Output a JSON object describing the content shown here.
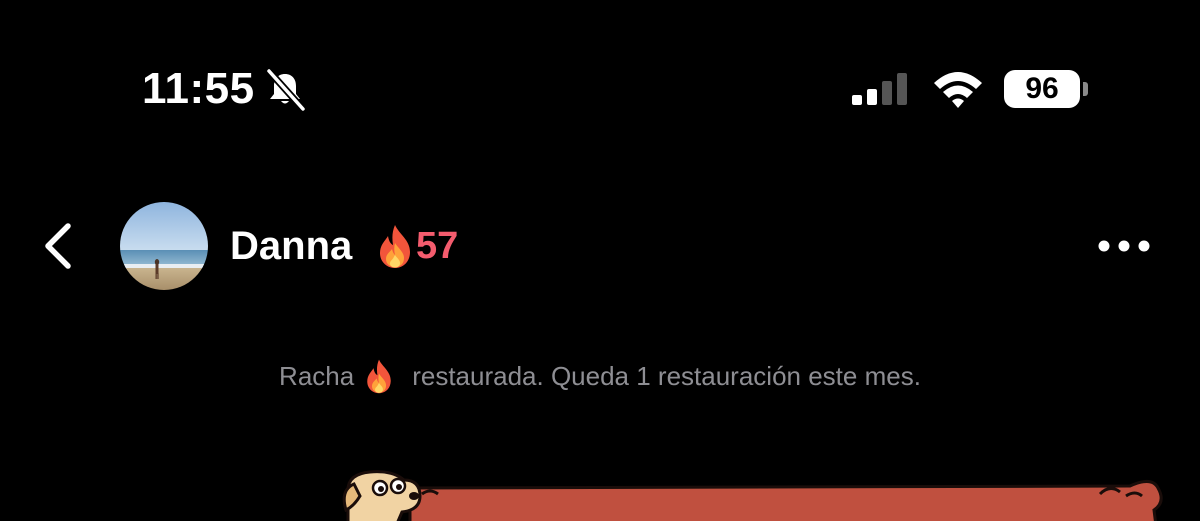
{
  "status_bar": {
    "time": "11:55",
    "battery_level": "96",
    "mute_icon": "bell-slash-icon",
    "signal_icon": "cellular-signal-icon",
    "wifi_icon": "wifi-icon"
  },
  "chat_header": {
    "back_icon": "chevron-left-icon",
    "contact_name": "Danna",
    "streak_icon": "fire-icon",
    "streak_count": "57",
    "more_icon": "ellipsis-icon",
    "streak_color": "#f45c6e"
  },
  "system_message": {
    "before": "Racha",
    "after": "restaurada. Queda 1 restauración este mes."
  },
  "sticker": {
    "icon": "dog-sticker-icon",
    "color": "#c0503f"
  }
}
